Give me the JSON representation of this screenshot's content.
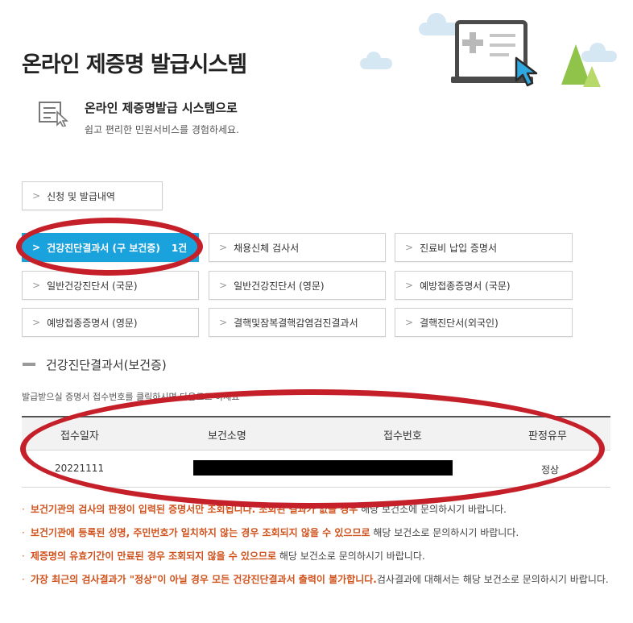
{
  "header": {
    "title": "온라인 제증명 발급시스템"
  },
  "intro": {
    "title": "온라인 제증명발급 시스템으로",
    "subtitle": "쉽고 편리한 민원서비스를 경험하세요."
  },
  "history_button": {
    "label": "신청 및 발급내역"
  },
  "cert_buttons": [
    {
      "label": "건강진단결과서 (구 보건증)",
      "count": "1건"
    },
    {
      "label": "채용신체 검사서"
    },
    {
      "label": "진료비 납입 증명서"
    },
    {
      "label": "일반건강진단서 (국문)"
    },
    {
      "label": "일반건강진단서 (영문)"
    },
    {
      "label": "예방접종증명서 (국문)"
    },
    {
      "label": "예방접종증명서 (영문)"
    },
    {
      "label": "결핵및잠복결핵감염검진결과서"
    },
    {
      "label": "결핵진단서(외국인)"
    }
  ],
  "section": {
    "title": "건강진단결과서(보건증)",
    "description": "발급받으실 증명서 접수번호를 클릭하시면 다운로드 하세요"
  },
  "table": {
    "headers": [
      "접수일자",
      "보건소명",
      "접수번호",
      "판정유무"
    ],
    "rows": [
      {
        "date": "20221111",
        "office": "",
        "number": "",
        "result": "정상"
      }
    ]
  },
  "notes": [
    {
      "highlight": "보건기관의 검사의 판정이 입력된 증명서만 조회됩니다. 조회된 결과가 없을 경우",
      "rest": " 해당 보건소에 문의하시기 바랍니다."
    },
    {
      "highlight": "보건기관에 등록된 성명, 주민번호가 일치하지 않는 경우 조회되지 않을 수 있으므로",
      "rest": " 해당 보건소로 문의하시기 바랍니다."
    },
    {
      "highlight": "제증명의 유효기간이 만료된 경우 조회되지 않을 수 있으므로",
      "rest": " 해당 보건소로 문의하시기 바랍니다."
    },
    {
      "highlight": "가장 최근의 검사결과가 \"정상\"이 아닐 경우 모든 건강진단결과서 출력이 불가합니다.",
      "rest": "검사결과에 대해서는 해당 보건소로 문의하시기 바랍니다."
    }
  ],
  "colors": {
    "accent": "#1aa2dc",
    "annotation": "#c5202a",
    "note_highlight": "#d0521c"
  }
}
